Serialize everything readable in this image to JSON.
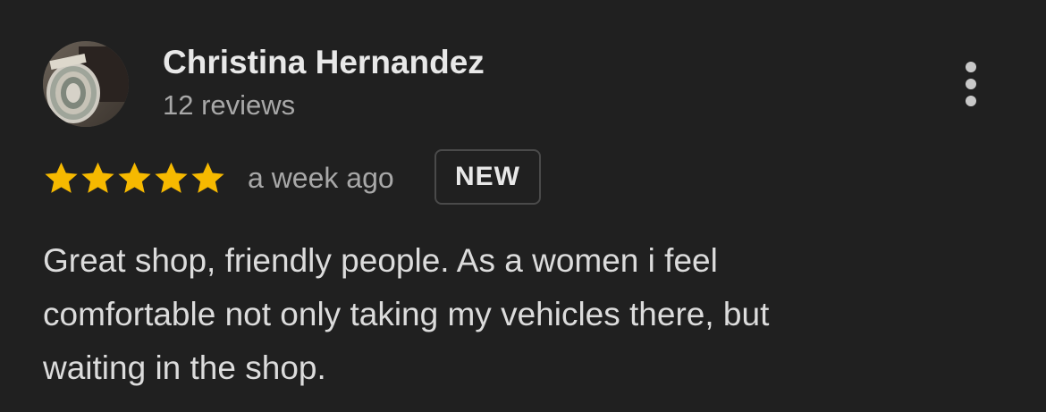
{
  "review": {
    "author": {
      "name": "Christina Hernandez",
      "review_count": "12 reviews",
      "avatar_icon": "profile-photo-avatar"
    },
    "rating": 5,
    "rating_max": 5,
    "star_color": "#f6b900",
    "time_ago": "a week ago",
    "badge": "NEW",
    "text_lines": [
      "Great shop, friendly people. As a women i feel",
      "comfortable not only taking my vehicles there, but",
      "waiting in the shop."
    ],
    "more_icon": "more-vert-icon"
  }
}
